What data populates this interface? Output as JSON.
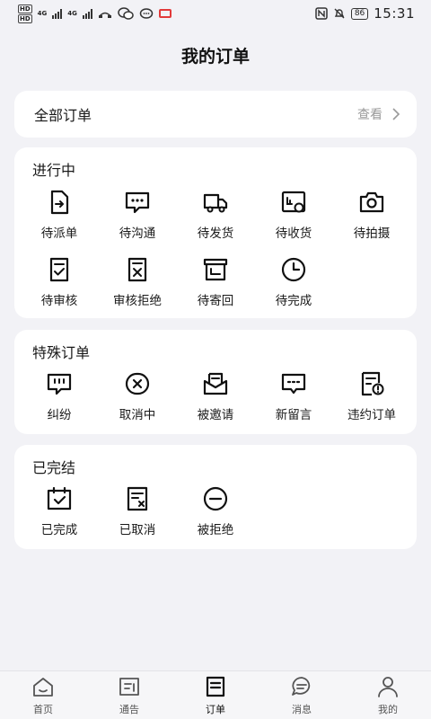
{
  "status_bar": {
    "hd1": "HD",
    "hd2": "HD",
    "net1": "4G",
    "net2": "4G",
    "battery": "86",
    "time": "15:31"
  },
  "header": {
    "title": "我的订单"
  },
  "all_orders": {
    "label": "全部订单",
    "view_label": "查看"
  },
  "in_progress": {
    "title": "进行中",
    "items": [
      {
        "label": "待派单",
        "icon": "dispatch-doc-icon"
      },
      {
        "label": "待沟通",
        "icon": "chat-bubble-icon"
      },
      {
        "label": "待发货",
        "icon": "truck-icon"
      },
      {
        "label": "待收货",
        "icon": "receive-box-icon"
      },
      {
        "label": "待拍摄",
        "icon": "camera-icon"
      },
      {
        "label": "待审核",
        "icon": "review-doc-icon"
      },
      {
        "label": "审核拒绝",
        "icon": "reject-doc-icon"
      },
      {
        "label": "待寄回",
        "icon": "return-box-icon"
      },
      {
        "label": "待完成",
        "icon": "clock-icon"
      }
    ]
  },
  "special_orders": {
    "title": "特殊订单",
    "items": [
      {
        "label": "纠纷",
        "icon": "dispute-chat-icon"
      },
      {
        "label": "取消中",
        "icon": "cancel-circle-icon"
      },
      {
        "label": "被邀请",
        "icon": "invite-envelope-icon"
      },
      {
        "label": "新留言",
        "icon": "message-icon"
      },
      {
        "label": "违约订单",
        "icon": "breach-doc-icon"
      }
    ]
  },
  "completed": {
    "title": "已完结",
    "items": [
      {
        "label": "已完成",
        "icon": "completed-calendar-icon"
      },
      {
        "label": "已取消",
        "icon": "cancelled-doc-icon"
      },
      {
        "label": "被拒绝",
        "icon": "rejected-circle-icon"
      }
    ]
  },
  "tab_bar": {
    "items": [
      {
        "label": "首页",
        "icon": "home-icon"
      },
      {
        "label": "通告",
        "icon": "notice-icon"
      },
      {
        "label": "订单",
        "icon": "order-icon",
        "active": true
      },
      {
        "label": "消息",
        "icon": "message-bubble-icon"
      },
      {
        "label": "我的",
        "icon": "profile-icon"
      }
    ]
  }
}
